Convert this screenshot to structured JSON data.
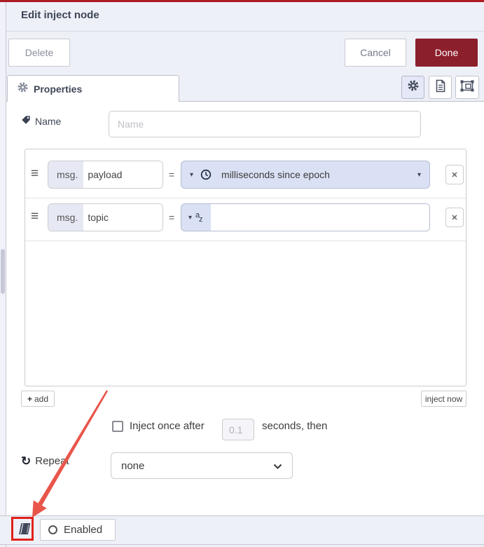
{
  "header": {
    "title": "Edit inject node"
  },
  "toolbar": {
    "delete": "Delete",
    "cancel": "Cancel",
    "done": "Done"
  },
  "tabs": {
    "properties": "Properties"
  },
  "name_row": {
    "label": "Name",
    "placeholder": "Name"
  },
  "rules": {
    "rows": [
      {
        "prefix": "msg.",
        "key": "payload",
        "eq": "=",
        "type_label": "milliseconds since epoch"
      },
      {
        "prefix": "msg.",
        "key": "topic",
        "eq": "=",
        "az_a": "a",
        "az_z": "z",
        "value": ""
      }
    ],
    "add": "add",
    "inject_now": "inject now"
  },
  "once": {
    "label": "Inject once after",
    "value": "0.1",
    "suffix": "seconds, then"
  },
  "repeat": {
    "label": "Repeat",
    "value": "none"
  },
  "footer": {
    "enabled": "Enabled"
  },
  "icons": {
    "hamburger": "≡",
    "caret_down": "▾",
    "close": "✕",
    "plus": "+",
    "repeat": "↻"
  },
  "colors": {
    "done_button": "#8c1f2c",
    "top_bar": "#ad1c23",
    "typed_input_bg": "#dbe1f5",
    "arrow_red": "#e8564b",
    "highlight_red": "#e0211a"
  }
}
